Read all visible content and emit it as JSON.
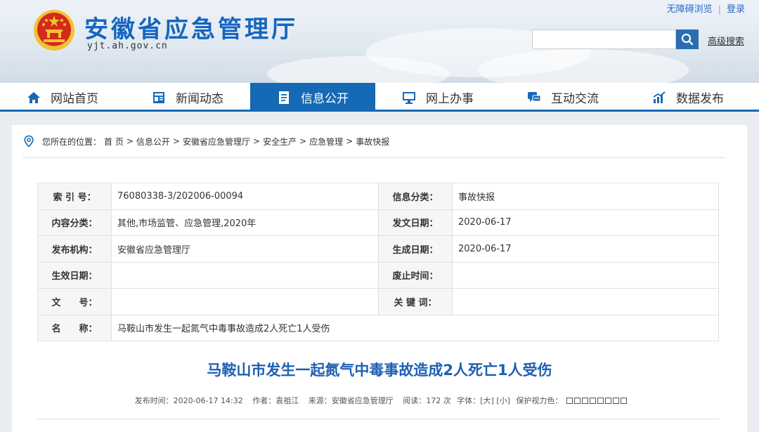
{
  "header": {
    "title": "安徽省应急管理厅",
    "url": "yjt.ah.gov.cn",
    "accessibility_link": "无障碍浏览",
    "login_link": "登录",
    "search_placeholder": "",
    "advanced_search": "高级搜索"
  },
  "nav": [
    {
      "label": "网站首页",
      "icon": "home-icon"
    },
    {
      "label": "新闻动态",
      "icon": "news-icon"
    },
    {
      "label": "信息公开",
      "icon": "document-icon",
      "active": true
    },
    {
      "label": "网上办事",
      "icon": "monitor-icon"
    },
    {
      "label": "互动交流",
      "icon": "chat-icon"
    },
    {
      "label": "数据发布",
      "icon": "chart-icon"
    }
  ],
  "breadcrumb": {
    "prefix": "您所在的位置：",
    "items": [
      "首 页",
      "信息公开",
      "安徽省应急管理厅",
      "安全生产",
      "应急管理",
      "事故快报"
    ],
    "separator": ">"
  },
  "info": {
    "index_label": "索 引 号：",
    "index_value": "76080338-3/202006-00094",
    "category_label": "信息分类：",
    "category_value": "事故快报",
    "content_label": "内容分类：",
    "content_value": "其他,市场监管、应急管理,2020年",
    "issue_date_label": "发文日期：",
    "issue_date_value": "2020-06-17",
    "publisher_label": "发布机构：",
    "publisher_value": "安徽省应急管理厅",
    "created_label": "生成日期：",
    "created_value": "2020-06-17",
    "effective_label": "生效日期：",
    "effective_value": "",
    "abolish_label": "废止时间：",
    "abolish_value": "",
    "doc_no_label": "文　　号：",
    "doc_no_value": "",
    "keywords_label": "关 键 词：",
    "keywords_value": "",
    "name_label": "名　　称：",
    "name_value": "马鞍山市发生一起氮气中毒事故造成2人死亡1人受伤"
  },
  "article": {
    "title": "马鞍山市发生一起氮气中毒事故造成2人死亡1人受伤",
    "publish_time": "发布时间：2020-06-17 14:32",
    "author": "作者：袁祖江",
    "source": "来源：安徽省应急管理厅",
    "reads": "阅读：172 次",
    "font_label": "字体：",
    "font_large": "[大]",
    "font_small": "[小]",
    "vision_label": "保护视力色："
  },
  "colors": {
    "brand_blue": "#1669b5",
    "title_blue": "#1d5fb3",
    "emblem_red": "#d42a1a",
    "emblem_gold": "#f1c233"
  }
}
